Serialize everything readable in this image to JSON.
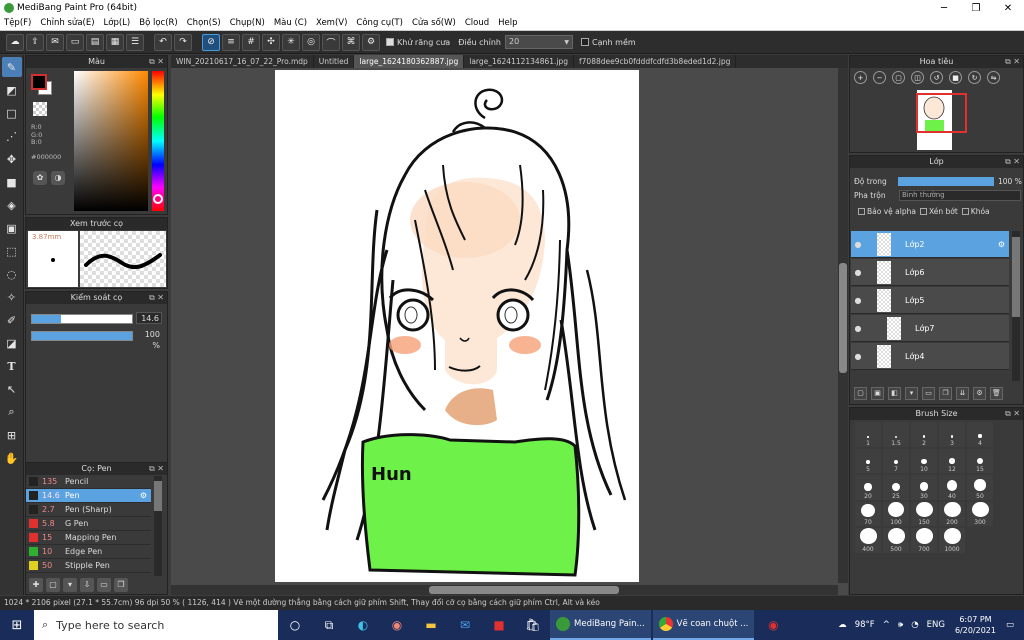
{
  "window": {
    "title": "MediBang Paint Pro (64bit)",
    "min": "─",
    "max": "❐",
    "close": "✕"
  },
  "menu": [
    "Tệp(F)",
    "Chỉnh sửa(E)",
    "Lớp(L)",
    "Bộ lọc(R)",
    "Chọn(S)",
    "Chụp(N)",
    "Màu (C)",
    "Xem(V)",
    "Công cụ(T)",
    "Cửa số(W)",
    "Cloud",
    "Help"
  ],
  "toolbar": {
    "antialias_label": "Khử răng cưa",
    "adjust_label": "Điều chỉnh",
    "adjust_value": "20",
    "smooth_label": "Cạnh mềm"
  },
  "color_panel": {
    "title": "Màu",
    "r": "R:0",
    "g": "G:0",
    "b": "B:0",
    "hex": "#000000"
  },
  "brush_preview": {
    "title": "Xem trước cọ",
    "size": "3.87mm"
  },
  "brush_control": {
    "title": "Kiểm soát cọ",
    "size_value": "14.6",
    "opacity_value": "100 %",
    "size_fraction": 0.29,
    "opacity_fraction": 1.0
  },
  "brush_list": {
    "title": "Cọ: Pen",
    "items": [
      {
        "size": "135",
        "name": "Pencil",
        "color": "#222222"
      },
      {
        "size": "14.6",
        "name": "Pen",
        "color": "#222222",
        "selected": true
      },
      {
        "size": "2.7",
        "name": "Pen (Sharp)",
        "color": "#222222"
      },
      {
        "size": "5.8",
        "name": "G Pen",
        "color": "#e03030"
      },
      {
        "size": "15",
        "name": "Mapping Pen",
        "color": "#e03030"
      },
      {
        "size": "10",
        "name": "Edge Pen",
        "color": "#30b030"
      },
      {
        "size": "50",
        "name": "Stipple Pen",
        "color": "#e0d020"
      }
    ]
  },
  "tabs": [
    "WIN_20210617_16_07_22_Pro.mdp",
    "Untitled",
    "large_1624180362887.jpg",
    "large_1624112134861.jpg",
    "f7088dee9cb0fdddfcdfd3b8eded1d2.jpg"
  ],
  "selected_tab": 2,
  "drawing": {
    "shirt_text": "Hun"
  },
  "navigator": {
    "title": "Hoa tiêu"
  },
  "layers": {
    "title": "Lớp",
    "opacity_label": "Độ trong",
    "opacity_value": "100 %",
    "opacity_fraction": 1.0,
    "blend_label": "Pha trộn",
    "blend_value": "Bình thường",
    "protect_alpha": "Bảo vệ alpha",
    "clip": "Xén bớt",
    "lock": "Khóa",
    "items": [
      {
        "name": "Lớp2",
        "selected": true
      },
      {
        "name": "Lớp6"
      },
      {
        "name": "Lớp5"
      },
      {
        "name": "Lớp7",
        "indent": true
      },
      {
        "name": "Lớp4"
      }
    ]
  },
  "brush_size": {
    "title": "Brush Size",
    "sizes": [
      "1",
      "1.5",
      "2",
      "3",
      "4",
      "5",
      "7",
      "10",
      "12",
      "15",
      "20",
      "25",
      "30",
      "40",
      "50",
      "70",
      "100",
      "150",
      "200",
      "300",
      "400",
      "500",
      "700",
      "1000"
    ]
  },
  "status": "1024 * 2106 pixel  (27.1 * 55.7cm)  96 dpi  50 %  ( 1126, 414 )  Vẽ một đường thẳng bằng cách giữ phím Shift, Thay đổi cỡ cọ bằng cách giữ phím Ctrl, Alt và kéo",
  "taskbar": {
    "search_placeholder": "Type here to search",
    "app1": "MediBang Pain...",
    "app2": "Vẽ coan chuột ...",
    "weather": "98°F",
    "lang": "ENG",
    "time": "6:07 PM",
    "date": "6/20/2021"
  }
}
